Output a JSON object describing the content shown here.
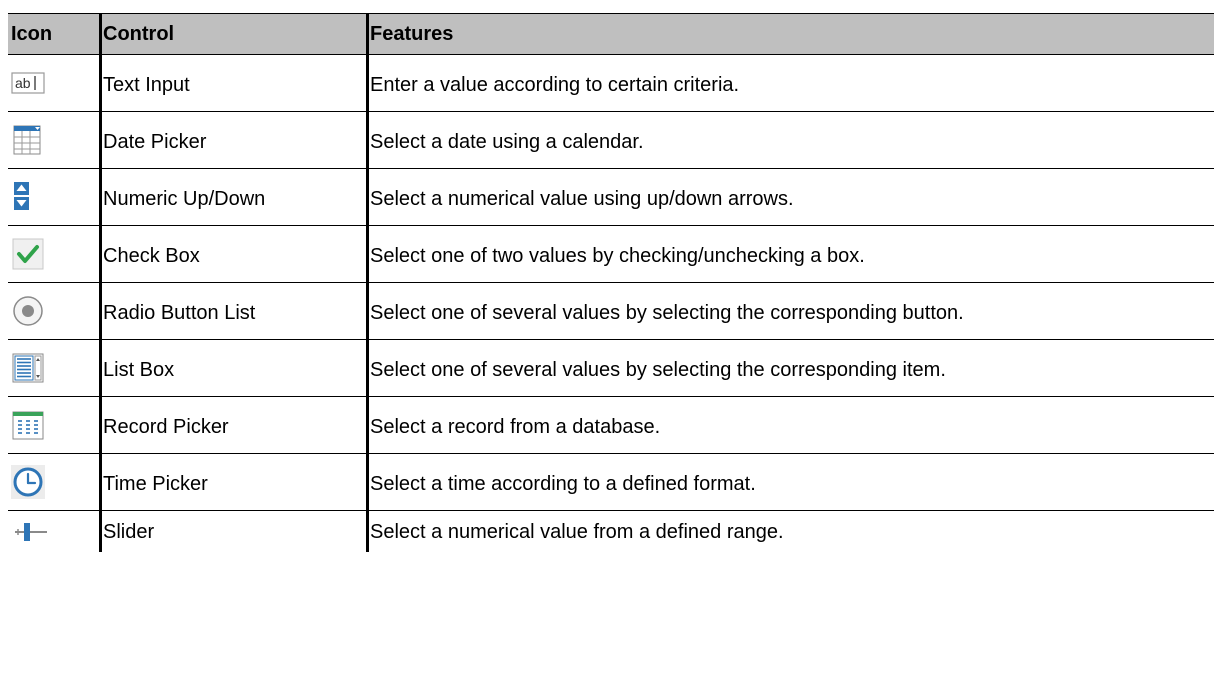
{
  "table": {
    "headers": {
      "icon": "Icon",
      "control": "Control",
      "features": "Features"
    },
    "rows": [
      {
        "icon": "text-input-icon",
        "control": "Text Input",
        "features": "Enter a value according to certain criteria."
      },
      {
        "icon": "date-picker-icon",
        "control": "Date Picker",
        "features": "Select a date using a calendar."
      },
      {
        "icon": "numeric-updown-icon",
        "control": "Numeric Up/Down",
        "features": "Select a numerical value using up/down arrows."
      },
      {
        "icon": "check-box-icon",
        "control": "Check Box",
        "features": "Select one of two values by checking/unchecking a box."
      },
      {
        "icon": "radio-button-icon",
        "control": "Radio Button List",
        "features": "Select one of several values by selecting the corresponding button."
      },
      {
        "icon": "list-box-icon",
        "control": "List Box",
        "features": "Select one of several values by selecting the corresponding item."
      },
      {
        "icon": "record-picker-icon",
        "control": "Record Picker",
        "features": "Select a record from a database."
      },
      {
        "icon": "time-picker-icon",
        "control": "Time Picker",
        "features": "Select a time according to a defined format."
      },
      {
        "icon": "slider-icon",
        "control": "Slider",
        "features": "Select a numerical value from a defined range."
      }
    ]
  },
  "colors": {
    "header_bg": "#bfbfbf",
    "icon_blue": "#2e75b6",
    "check_green": "#2fa34a",
    "icon_gray": "#8a8a8a"
  }
}
